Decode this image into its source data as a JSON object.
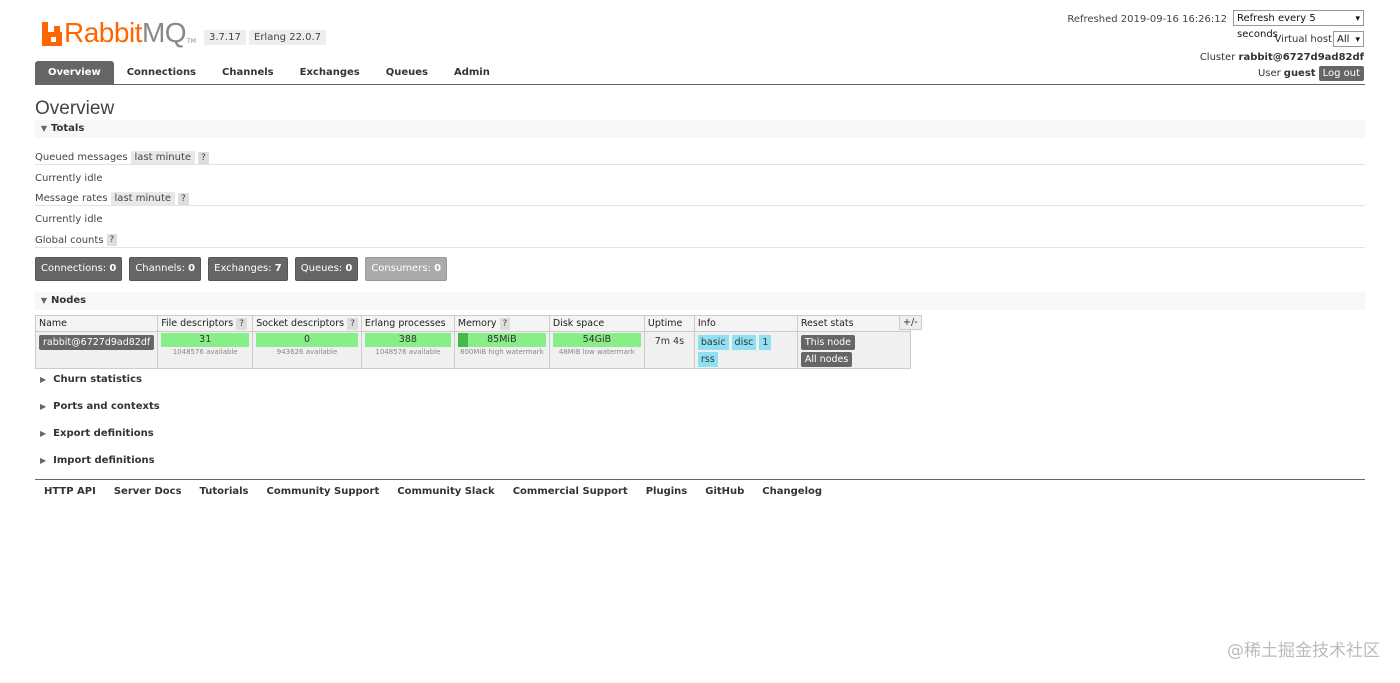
{
  "header": {
    "logo_primary": "Rabbit",
    "logo_secondary": "MQ",
    "logo_tm": "TM",
    "version": "3.7.17",
    "erlang": "Erlang 22.0.7",
    "refreshed": "Refreshed 2019-09-16 16:26:12",
    "refresh_select": "Refresh every 5 seconds",
    "vhost_label": "Virtual host",
    "vhost_select": "All",
    "cluster_label": "Cluster",
    "cluster_name": "rabbit@6727d9ad82df",
    "user_label": "User",
    "user_name": "guest",
    "logout": "Log out"
  },
  "tabs": [
    "Overview",
    "Connections",
    "Channels",
    "Exchanges",
    "Queues",
    "Admin"
  ],
  "overview": {
    "title": "Overview",
    "totals_title": "Totals",
    "queued_label": "Queued messages",
    "queued_range": "last minute",
    "help": "?",
    "idle1": "Currently idle",
    "rates_label": "Message rates",
    "rates_range": "last minute",
    "idle2": "Currently idle",
    "global_label": "Global counts"
  },
  "counts": [
    {
      "label": "Connections:",
      "value": "0"
    },
    {
      "label": "Channels:",
      "value": "0"
    },
    {
      "label": "Exchanges:",
      "value": "7"
    },
    {
      "label": "Queues:",
      "value": "0"
    },
    {
      "label": "Consumers:",
      "value": "0"
    }
  ],
  "nodes": {
    "title": "Nodes",
    "plusminus": "+/-",
    "columns": [
      "Name",
      "File descriptors",
      "Socket descriptors",
      "Erlang processes",
      "Memory",
      "Disk space",
      "Uptime",
      "Info",
      "Reset stats"
    ],
    "row": {
      "name": "rabbit@6727d9ad82df",
      "fd_value": "31",
      "fd_sub": "1048576 available",
      "sd_value": "0",
      "sd_sub": "943626 available",
      "ep_value": "388",
      "ep_sub": "1048576 available",
      "mem_value": "85MiB",
      "mem_fraction": 0.11,
      "mem_sub": "800MiB high watermark",
      "disk_value": "54GiB",
      "disk_sub": "48MiB low watermark",
      "uptime": "7m 4s",
      "info": [
        "basic",
        "disc",
        "1",
        "rss"
      ],
      "reset_this": "This node",
      "reset_all": "All nodes"
    }
  },
  "collapsed_sections": [
    "Churn statistics",
    "Ports and contexts",
    "Export definitions",
    "Import definitions"
  ],
  "footer": [
    "HTTP API",
    "Server Docs",
    "Tutorials",
    "Community Support",
    "Community Slack",
    "Commercial Support",
    "Plugins",
    "GitHub",
    "Changelog"
  ],
  "watermark": "@稀土掘金技术社区",
  "colors": {
    "accent": "#ff6600",
    "bar": "#88ee88",
    "info_badge": "#8fe0f0"
  }
}
